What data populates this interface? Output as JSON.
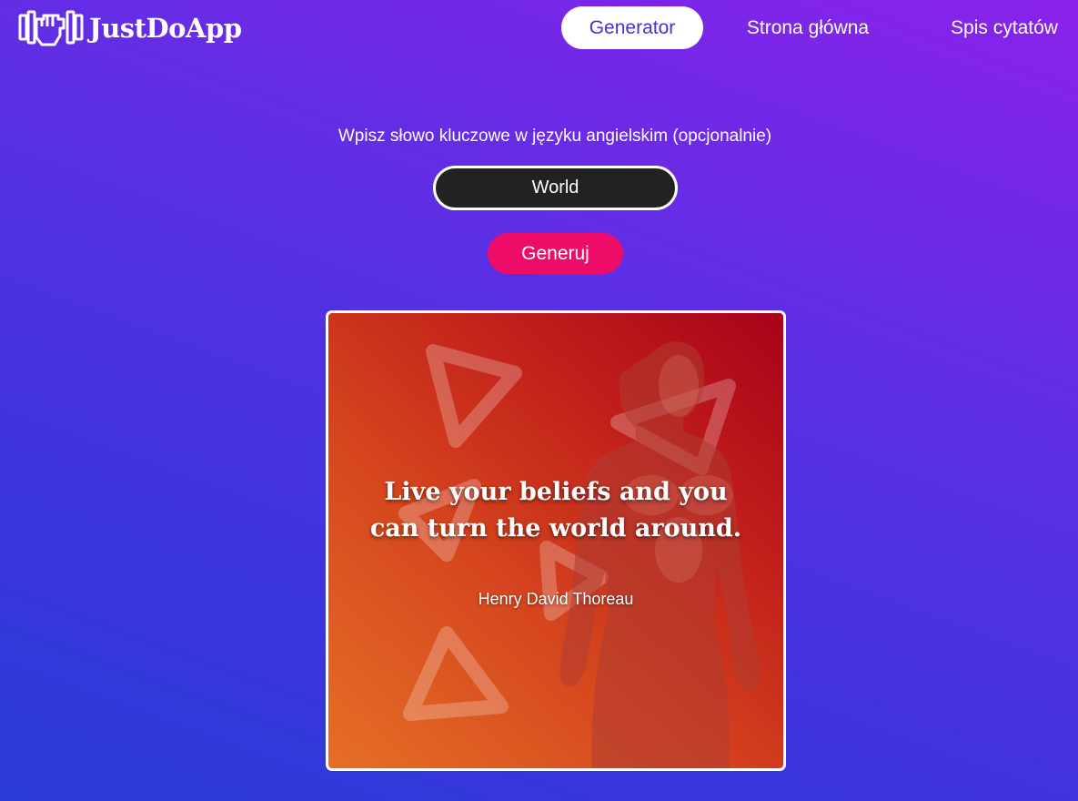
{
  "brand": {
    "name": "JustDoApp",
    "logo_icon": "fist-dumbbell-icon"
  },
  "nav": {
    "items": [
      {
        "label": "Generator",
        "active": true
      },
      {
        "label": "Strona główna",
        "active": false
      },
      {
        "label": "Spis cytatów",
        "active": false
      }
    ]
  },
  "form": {
    "prompt": "Wpisz słowo kluczowe w języku angielskim (opcjonalnie)",
    "keyword_value": "World",
    "generate_label": "Generuj"
  },
  "quote_card": {
    "quote": "Live your beliefs and you can turn the world around.",
    "author": "Henry David Thoreau"
  },
  "colors": {
    "background_top": "#8a22ea",
    "background_bottom": "#2a3bd6",
    "generate_button": "#ee0c69",
    "input_background": "#222222",
    "card_red": "#a8021a",
    "card_orange": "#e56f26"
  }
}
